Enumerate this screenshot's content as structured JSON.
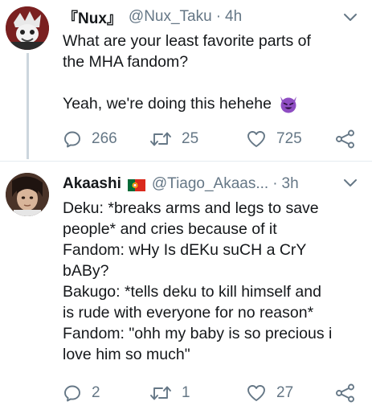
{
  "tweets": [
    {
      "display_name": "『Nux』",
      "handle": "@Nux_Taku",
      "separator": "·",
      "time": "4h",
      "lines": [
        "What are your least favorite parts of",
        "the MHA fandom?",
        "",
        "Yeah, we're doing this hehehe"
      ],
      "emoji": "smiling-devil-icon",
      "reply_count": "266",
      "retweet_count": "25",
      "like_count": "725"
    },
    {
      "display_name": "Akaashi",
      "flag": "portugal-flag-icon",
      "handle": "@Tiago_Akaas...",
      "separator": "·",
      "time": "3h",
      "lines": [
        "Deku: *breaks arms and legs to save",
        "people* and cries because of it",
        "Fandom: wHy Is dEKu suCH a CrY",
        "bABy?",
        "Bakugo: *tells deku to kill himself and",
        "is rude with everyone for no reason*",
        "Fandom: \"ohh my baby is so precious i",
        "love him so much\""
      ],
      "reply_count": "2",
      "retweet_count": "1",
      "like_count": "27"
    }
  ],
  "colors": {
    "text": "#14171a",
    "muted": "#657786",
    "divider": "#e6ecf0",
    "thread_line": "#ccd6dd",
    "devil_purple": "#8e4dc2"
  }
}
